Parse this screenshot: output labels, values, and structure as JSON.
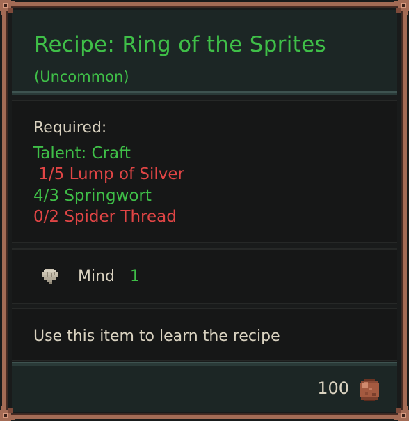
{
  "tooltip": {
    "title": "Recipe: Ring of the Sprites",
    "rarity": "(Uncommon)",
    "requirements": {
      "label": "Required:",
      "lines": [
        {
          "text": "Talent: Craft",
          "met": true
        },
        {
          "text": " 1/5 Lump of Silver",
          "met": false
        },
        {
          "text": "4/3 Springwort",
          "met": true
        },
        {
          "text": "0/2 Spider Thread",
          "met": false
        }
      ]
    },
    "stat": {
      "icon": "brain-icon",
      "name": "Mind",
      "value": "1"
    },
    "description": "Use this item to learn the recipe",
    "price": {
      "value": "100",
      "icon": "coin-icon"
    }
  },
  "colors": {
    "positive": "#3fbf48",
    "negative": "#e04545",
    "text": "#d9d2c0",
    "border": "#a36b55"
  }
}
